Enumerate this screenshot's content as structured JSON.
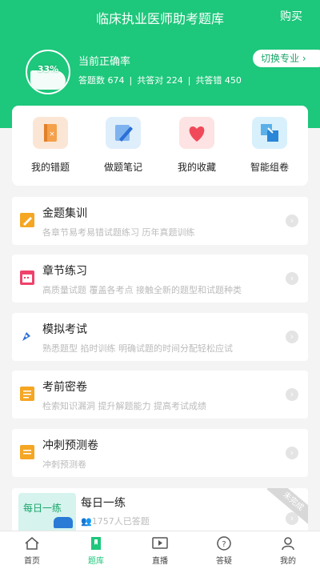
{
  "header": {
    "title": "临床执业医师助考题库",
    "buy": "购买",
    "accuracy_percent": "33%",
    "accuracy_label": "当前正确率",
    "stats": {
      "answered": "答题数 674",
      "correct": "共答对 224",
      "wrong": "共答错 450"
    },
    "switch_label": "切换专业 ›"
  },
  "quick": [
    {
      "label": "我的错题",
      "icon": "notebook-icon",
      "color": "#fbe6d6"
    },
    {
      "label": "做题笔记",
      "icon": "pen-icon",
      "color": "#dfeefb"
    },
    {
      "label": "我的收藏",
      "icon": "heart-icon",
      "color": "#fde3e3"
    },
    {
      "label": "智能组卷",
      "icon": "shuffle-icon",
      "color": "#d8f0fb"
    }
  ],
  "list": [
    {
      "title": "金题集训",
      "sub": "各章节易考易错试题练习 历年真题训练",
      "icon": "pencil-icon",
      "color": "#f5a623"
    },
    {
      "title": "章节练习",
      "sub": "高质量试题 覆盖各考点 接触全新的题型和试题种类",
      "icon": "calendar-icon",
      "color": "#f0416a"
    },
    {
      "title": "模拟考试",
      "sub": "熟悉题型 掐时训练 明确试题的时间分配轻松应试",
      "icon": "pen-nib-icon",
      "color": "#2a6fd6"
    },
    {
      "title": "考前密卷",
      "sub": "检索知识漏洞 提升解题能力 提高考试成绩",
      "icon": "document-icon",
      "color": "#f5a623"
    },
    {
      "title": "冲刺预测卷",
      "sub": "冲刺预测卷",
      "icon": "scroll-icon",
      "color": "#f5a623"
    }
  ],
  "daily": {
    "thumb_text": "每日一练",
    "title": "每日一练",
    "sub": "1757人已答题",
    "ribbon": "未完成"
  },
  "tabs": [
    {
      "label": "首页",
      "icon": "home-icon"
    },
    {
      "label": "题库",
      "icon": "bookmark-icon"
    },
    {
      "label": "直播",
      "icon": "play-icon"
    },
    {
      "label": "答疑",
      "icon": "question-icon"
    },
    {
      "label": "我的",
      "icon": "user-icon"
    }
  ],
  "colors": {
    "brand": "#1dc77b"
  }
}
